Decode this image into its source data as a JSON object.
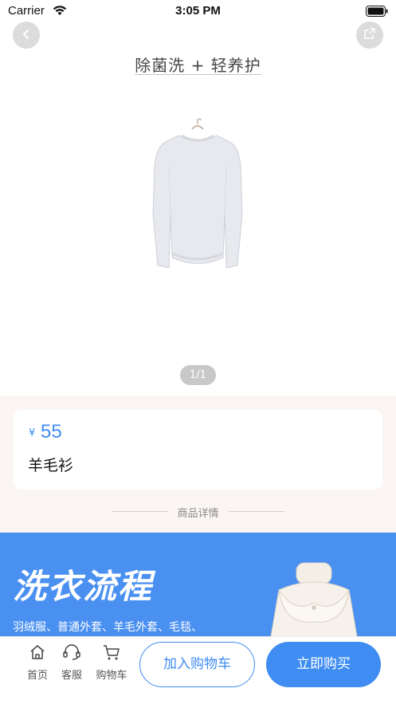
{
  "status_bar": {
    "carrier": "Carrier",
    "time": "3:05 PM"
  },
  "header": {
    "back_icon": "chevron-left-icon",
    "share_icon": "share-icon"
  },
  "hero": {
    "slogan": "除菌洗 + 轻养护",
    "product_image": "white-sweater-on-hanger",
    "page_indicator": "1/1"
  },
  "product": {
    "price_symbol": "¥",
    "price": "55",
    "name": "羊毛衫"
  },
  "details": {
    "divider_label": "商品详情"
  },
  "banner": {
    "title": "洗衣流程",
    "subtitle": "羽绒服、普通外套、羊毛外套、毛毯、",
    "image": "white-down-jacket"
  },
  "bottom_bar": {
    "nav": [
      {
        "label": "首页",
        "icon": "home-icon"
      },
      {
        "label": "客服",
        "icon": "headset-icon"
      },
      {
        "label": "购物车",
        "icon": "cart-icon"
      }
    ],
    "add_to_cart": "加入购物车",
    "buy_now": "立即购买"
  },
  "colors": {
    "accent": "#3f8cf2",
    "banner": "#4a90f0",
    "info_bg": "#fbf6f3"
  }
}
